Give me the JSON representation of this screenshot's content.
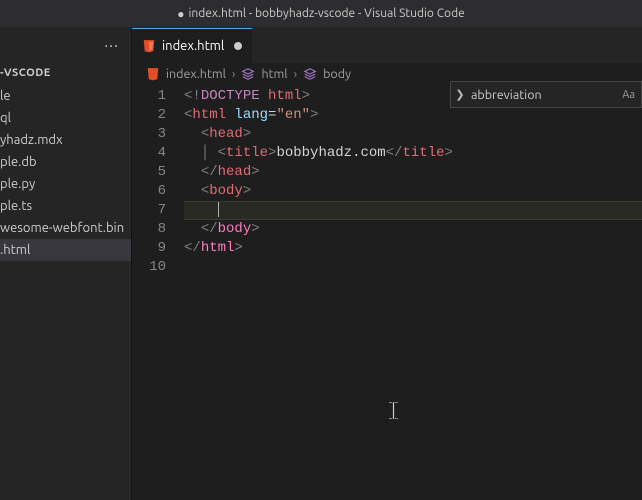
{
  "titlebar": {
    "modified_indicator": "●",
    "text": "index.html - bobbyhadz-vscode - Visual Studio Code"
  },
  "sidebar": {
    "menu_icon": "···",
    "section_title": "-VSCODE",
    "items": [
      {
        "name": "le"
      },
      {
        "name": "ql"
      },
      {
        "name": "yhadz.mdx"
      },
      {
        "name": "ple.db"
      },
      {
        "name": "ple.py"
      },
      {
        "name": "ple.ts"
      },
      {
        "name": "wesome-webfont.bin"
      },
      {
        "name": ".html"
      }
    ],
    "selected_index": 7
  },
  "tab": {
    "file_icon": "html5",
    "label": "index.html"
  },
  "breadcrumbs": [
    {
      "icon": "html5",
      "label": "index.html"
    },
    {
      "icon": "struct",
      "label": "html"
    },
    {
      "icon": "struct",
      "label": "body"
    }
  ],
  "code_lines": [
    [
      {
        "c": "t-gray",
        "t": "<!"
      },
      {
        "c": "t-doctype",
        "t": "DOCTYPE"
      },
      {
        "c": "t-gray",
        "t": " "
      },
      {
        "c": "t-red",
        "t": "html"
      },
      {
        "c": "t-gray",
        "t": ">"
      }
    ],
    [
      {
        "c": "t-gray",
        "t": "<"
      },
      {
        "c": "t-red",
        "t": "html"
      },
      {
        "c": "t-white",
        "t": " "
      },
      {
        "c": "t-attr",
        "t": "lang"
      },
      {
        "c": "t-white",
        "t": "="
      },
      {
        "c": "t-str",
        "t": "\"en\""
      },
      {
        "c": "t-gray",
        "t": ">"
      }
    ],
    [
      {
        "c": "t-white",
        "t": "  "
      },
      {
        "c": "t-gray",
        "t": "<"
      },
      {
        "c": "t-red",
        "t": "head"
      },
      {
        "c": "t-gray",
        "t": ">"
      }
    ],
    [
      {
        "c": "t-white",
        "t": "  "
      },
      {
        "c": "t-gray",
        "t": "│ "
      },
      {
        "c": "t-gray",
        "t": "<"
      },
      {
        "c": "t-red",
        "t": "title"
      },
      {
        "c": "t-gray",
        "t": ">"
      },
      {
        "c": "t-white",
        "t": "bobbyhadz.com"
      },
      {
        "c": "t-gray",
        "t": "</"
      },
      {
        "c": "t-red",
        "t": "title"
      },
      {
        "c": "t-gray",
        "t": ">"
      }
    ],
    [
      {
        "c": "t-white",
        "t": "  "
      },
      {
        "c": "t-gray",
        "t": "</"
      },
      {
        "c": "t-red",
        "t": "head"
      },
      {
        "c": "t-gray",
        "t": ">"
      }
    ],
    [
      {
        "c": "t-white",
        "t": "  "
      },
      {
        "c": "t-gray",
        "t": "<"
      },
      {
        "c": "t-red",
        "t": "body"
      },
      {
        "c": "t-gray",
        "t": ">"
      }
    ],
    [
      {
        "c": "t-white",
        "t": "    "
      }
    ],
    [
      {
        "c": "t-white",
        "t": "  "
      },
      {
        "c": "t-gray",
        "t": "</"
      },
      {
        "c": "t-pink",
        "t": "body"
      },
      {
        "c": "t-gray",
        "t": ">"
      }
    ],
    [
      {
        "c": "t-gray",
        "t": "</"
      },
      {
        "c": "t-pink",
        "t": "html"
      },
      {
        "c": "t-gray",
        "t": ">"
      }
    ]
  ],
  "total_lines": 10,
  "active_line_index": 6,
  "suggest": {
    "arrow": "❯",
    "label": "abbreviation",
    "meta": "Aa"
  }
}
